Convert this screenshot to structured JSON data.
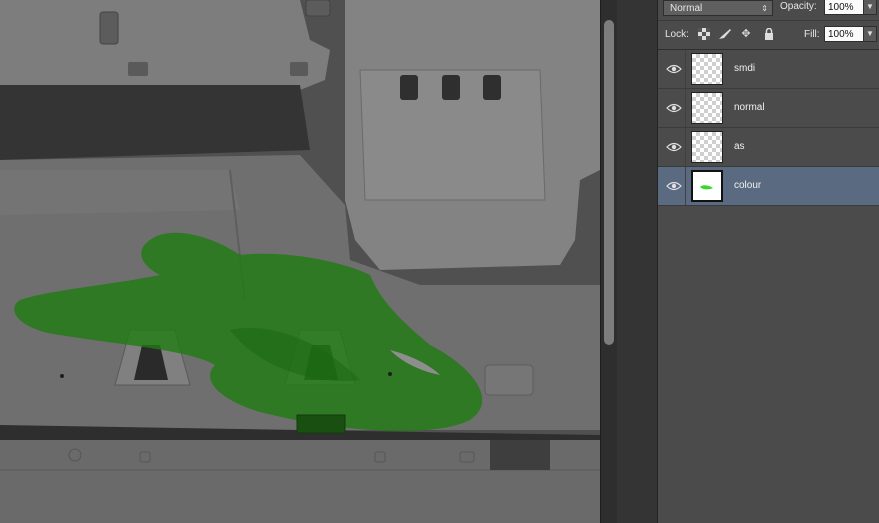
{
  "layers_panel": {
    "blend_mode": "Normal",
    "opacity_label": "Opacity:",
    "opacity_value": "100%",
    "lock_label": "Lock:",
    "fill_label": "Fill:",
    "fill_value": "100%",
    "layers": [
      {
        "name": "smdi",
        "visible": true,
        "selected": false
      },
      {
        "name": "normal",
        "visible": true,
        "selected": false
      },
      {
        "name": "as",
        "visible": true,
        "selected": false
      },
      {
        "name": "colour",
        "visible": true,
        "selected": true
      }
    ]
  },
  "colors": {
    "paint_green": "#1f7a12",
    "selected_layer": "#5a6a80"
  },
  "icons": {
    "lock_transparent": "checker-lock-icon",
    "lock_image": "brush-icon",
    "lock_position": "move-icon",
    "lock_all": "padlock-icon",
    "visibility": "eye-icon"
  }
}
